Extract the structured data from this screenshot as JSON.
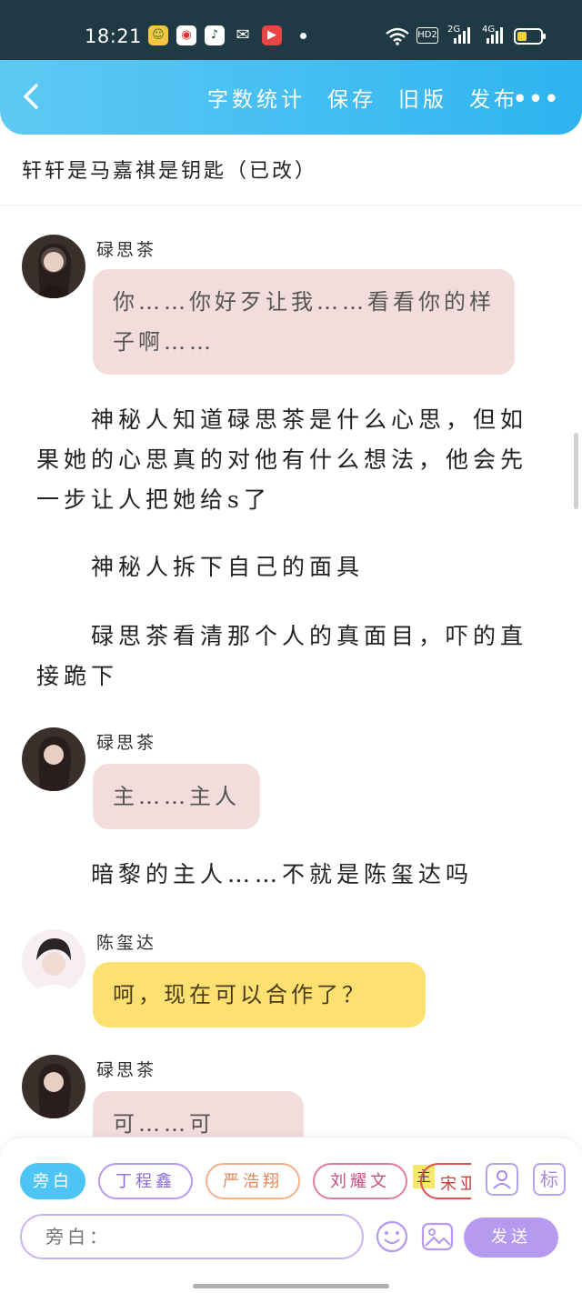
{
  "status_bar": {
    "time": "18:21",
    "app_icons": [
      "wechat-mini-icon",
      "weibo-icon",
      "tiktok-icon",
      "wechat-icon",
      "video-icon"
    ],
    "network": [
      "wifi-icon",
      "HD2",
      "2G",
      "4G",
      "battery-icon"
    ],
    "hd_label": "HD2",
    "net_2g": "2G",
    "net_4g": "4G"
  },
  "nav": {
    "back_icon": "chevron-left-icon",
    "items": [
      "字数统计",
      "保存",
      "旧版",
      "发布"
    ],
    "more_icon": "more-dots-icon"
  },
  "work_title": "轩轩是马嘉祺是钥匙（已改）",
  "content": {
    "messages": [
      {
        "speaker": "碌思茶",
        "text": "你……你好歹让我……看看你的样子啊……",
        "style": "pink"
      },
      {
        "narration": "　　神秘人知道碌思茶是什么心思，但如果她的心思真的对他有什么想法，他会先一步让人把她给s了"
      },
      {
        "narration": "　　神秘人拆下自己的面具"
      },
      {
        "narration": "　　碌思茶看清那个人的真面目，吓的直接跪下"
      },
      {
        "speaker": "碌思茶",
        "text": "主……主人",
        "style": "pink"
      },
      {
        "narration": "　　暗黎的主人……不就是陈玺达吗"
      },
      {
        "speaker": "陈玺达",
        "text": "呵，现在可以合作了？",
        "style": "yellow"
      },
      {
        "speaker": "碌思茶",
        "text": "可……可以……",
        "style": "pink"
      }
    ]
  },
  "bottom": {
    "chips": [
      {
        "label": "旁白",
        "active": true,
        "color": "#4cc4f4"
      },
      {
        "label": "丁程鑫",
        "active": false,
        "color": "#b69af0"
      },
      {
        "label": "严浩翔",
        "active": false,
        "color": "#f5b08a"
      },
      {
        "label": "刘耀文",
        "active": false,
        "color": "#e07ba0"
      },
      {
        "label": "主",
        "active": false,
        "color": "#f5e86a"
      },
      {
        "label": "宋亚",
        "active": false,
        "color": "#e05050"
      }
    ],
    "person_icon": "person-card-icon",
    "mark_label": "标",
    "input_placeholder": "旁白：",
    "emoji_icon": "smiley-icon",
    "image_icon": "image-icon",
    "send_label": "发送"
  }
}
